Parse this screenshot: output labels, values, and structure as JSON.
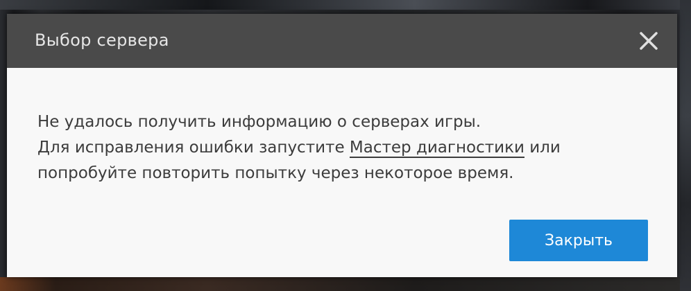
{
  "dialog": {
    "title": "Выбор сервера",
    "close_icon": "close-icon",
    "message": {
      "line1": "Не удалось получить информацию о серверах игры.",
      "line2_before": "Для исправления ошибки запустите ",
      "line2_link": "Мастер диагностики",
      "line2_after": " или",
      "line3": "попробуйте повторить попытку через некоторое время."
    },
    "close_button_label": "Закрыть"
  },
  "colors": {
    "header_bg": "#4a4a4a",
    "body_bg": "#f8f8f8",
    "accent": "#1e88d7",
    "text": "#3c3c3c"
  }
}
